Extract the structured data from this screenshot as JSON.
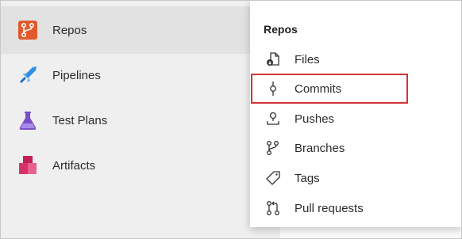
{
  "sidebar": {
    "items": [
      {
        "label": "Repos",
        "icon": "repos-icon",
        "active": true
      },
      {
        "label": "Pipelines",
        "icon": "pipelines-icon",
        "active": false
      },
      {
        "label": "Test Plans",
        "icon": "test-plans-icon",
        "active": false
      },
      {
        "label": "Artifacts",
        "icon": "artifacts-icon",
        "active": false
      }
    ]
  },
  "flyout": {
    "title": "Repos",
    "items": [
      {
        "label": "Files",
        "icon": "files-icon"
      },
      {
        "label": "Commits",
        "icon": "commits-icon",
        "highlighted": true
      },
      {
        "label": "Pushes",
        "icon": "pushes-icon"
      },
      {
        "label": "Branches",
        "icon": "branches-icon"
      },
      {
        "label": "Tags",
        "icon": "tag-icon"
      },
      {
        "label": "Pull requests",
        "icon": "pull-requests-icon"
      }
    ]
  },
  "colors": {
    "highlight": "#d13438",
    "repos_orange": "#e05a2b",
    "pipelines_blue": "#2f8fe0",
    "test_plans_purple": "#7a4fc9",
    "artifacts_pink": "#d6336c"
  }
}
